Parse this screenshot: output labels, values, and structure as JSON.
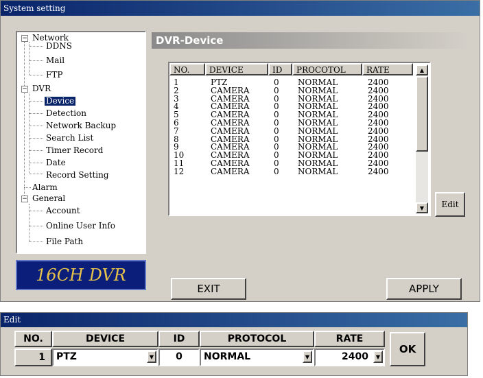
{
  "system_window": {
    "title": "System setting",
    "tree": {
      "network": "Network",
      "ddns": "DDNS",
      "mail": "Mail",
      "ftp": "FTP",
      "dvr": "DVR",
      "device": "Device",
      "detection": "Detection",
      "network_backup": "Network Backup",
      "search_list": "Search List",
      "timer_record": "Timer Record",
      "date": "Date",
      "record_setting": "Record Setting",
      "alarm": "Alarm",
      "general": "General",
      "account": "Account",
      "online_user_info": "Online User Info",
      "file_path": "File Path",
      "expand_minus": "−"
    },
    "logo": "16CH DVR",
    "section_title": "DVR-Device",
    "columns": [
      "NO.",
      "DEVICE",
      "ID",
      "PROCOTOL",
      "RATE"
    ],
    "rows": [
      [
        "1",
        "PTZ",
        "0",
        "NORMAL",
        "2400"
      ],
      [
        "2",
        "CAMERA",
        "0",
        "NORMAL",
        "2400"
      ],
      [
        "3",
        "CAMERA",
        "0",
        "NORMAL",
        "2400"
      ],
      [
        "4",
        "CAMERA",
        "0",
        "NORMAL",
        "2400"
      ],
      [
        "5",
        "CAMERA",
        "0",
        "NORMAL",
        "2400"
      ],
      [
        "6",
        "CAMERA",
        "0",
        "NORMAL",
        "2400"
      ],
      [
        "7",
        "CAMERA",
        "0",
        "NORMAL",
        "2400"
      ],
      [
        "8",
        "CAMERA",
        "0",
        "NORMAL",
        "2400"
      ],
      [
        "9",
        "CAMERA",
        "0",
        "NORMAL",
        "2400"
      ],
      [
        "10",
        "CAMERA",
        "0",
        "NORMAL",
        "2400"
      ],
      [
        "11",
        "CAMERA",
        "0",
        "NORMAL",
        "2400"
      ],
      [
        "12",
        "CAMERA",
        "0",
        "NORMAL",
        "2400"
      ]
    ],
    "scroll_up": "▲",
    "scroll_down": "▼",
    "edit_button": "Edit",
    "exit_button": "EXIT",
    "apply_button": "APPLY"
  },
  "edit_window": {
    "title": "Edit",
    "headers": [
      "NO.",
      "DEVICE",
      "ID",
      "PROTOCOL",
      "RATE"
    ],
    "no_value": "1",
    "device_value": "PTZ",
    "id_value": "0",
    "protocol_value": "NORMAL",
    "rate_value": "2400",
    "dropdown_arrow": "▼",
    "ok_button": "OK"
  }
}
